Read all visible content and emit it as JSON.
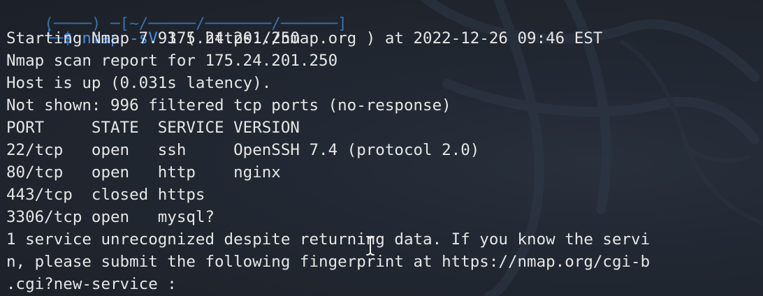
{
  "terminal": {
    "previous_prompt_fragment": "(────) ─[~/─────/───────/──────]",
    "prompt_corner": "└─",
    "prompt_symbol": "$",
    "command_name": "nmap",
    "command_flag": "-sV",
    "command_target": "175.24.201.250",
    "output_lines": [
      "Starting Nmap 7.93 ( https://nmap.org ) at 2022-12-26 09:46 EST",
      "Nmap scan report for 175.24.201.250",
      "Host is up (0.031s latency).",
      "Not shown: 996 filtered tcp ports (no-response)",
      "PORT     STATE  SERVICE VERSION",
      "22/tcp   open   ssh     OpenSSH 7.4 (protocol 2.0)",
      "80/tcp   open   http    nginx",
      "443/tcp  closed https",
      "3306/tcp open   mysql?",
      "1 service unrecognized despite returning data. If you know the servi",
      "n, please submit the following fingerprint at https://nmap.org/cgi-b",
      ".cgi?new-service :"
    ]
  },
  "colors": {
    "background": "#1f232b",
    "text": "#e6e6e6",
    "prompt_blue": "#2f7bd9"
  },
  "icons": {
    "cursor": "i-beam-cursor-icon",
    "watermark": "kali-dragon-watermark-icon"
  }
}
